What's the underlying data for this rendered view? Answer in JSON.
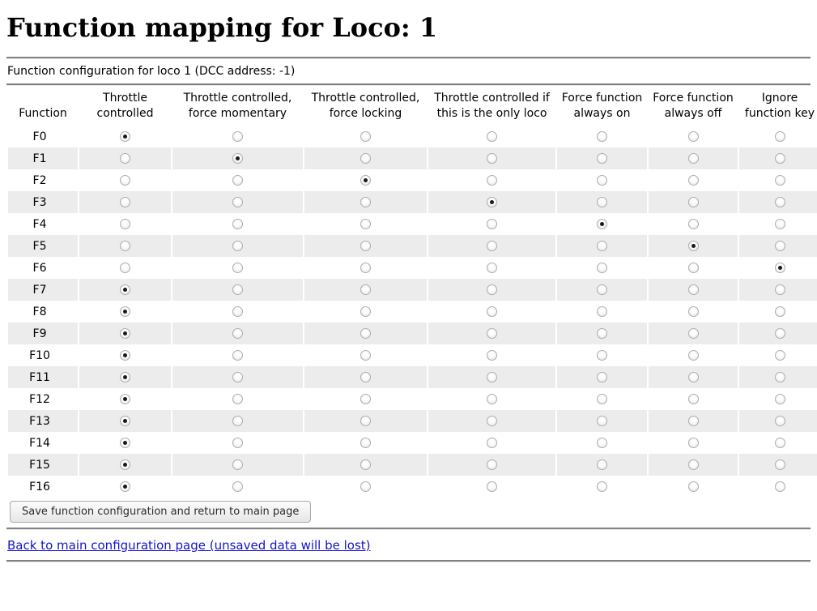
{
  "header": {
    "title": "Function mapping for Loco: 1",
    "subtitle": "Function configuration for loco 1 (DCC address: -1)"
  },
  "table": {
    "columns": [
      "Function",
      "Throttle controlled",
      "Throttle controlled, force momentary",
      "Throttle controlled, force locking",
      "Throttle controlled if this is the only loco",
      "Force function always on",
      "Force function always off",
      "Ignore function key"
    ],
    "rows": [
      {
        "label": "F0",
        "selected": 0
      },
      {
        "label": "F1",
        "selected": 1
      },
      {
        "label": "F2",
        "selected": 2
      },
      {
        "label": "F3",
        "selected": 3
      },
      {
        "label": "F4",
        "selected": 4
      },
      {
        "label": "F5",
        "selected": 5
      },
      {
        "label": "F6",
        "selected": 6
      },
      {
        "label": "F7",
        "selected": 0
      },
      {
        "label": "F8",
        "selected": 0
      },
      {
        "label": "F9",
        "selected": 0
      },
      {
        "label": "F10",
        "selected": 0
      },
      {
        "label": "F11",
        "selected": 0
      },
      {
        "label": "F12",
        "selected": 0
      },
      {
        "label": "F13",
        "selected": 0
      },
      {
        "label": "F14",
        "selected": 0
      },
      {
        "label": "F15",
        "selected": 0
      },
      {
        "label": "F16",
        "selected": 0
      }
    ]
  },
  "actions": {
    "save_label": "Save function configuration and return to main page",
    "back_link_label": "Back to main configuration page (unsaved data will be lost)"
  },
  "colors": {
    "stripe": "#ececec",
    "rule": "#808080",
    "link": "#1414cc"
  }
}
